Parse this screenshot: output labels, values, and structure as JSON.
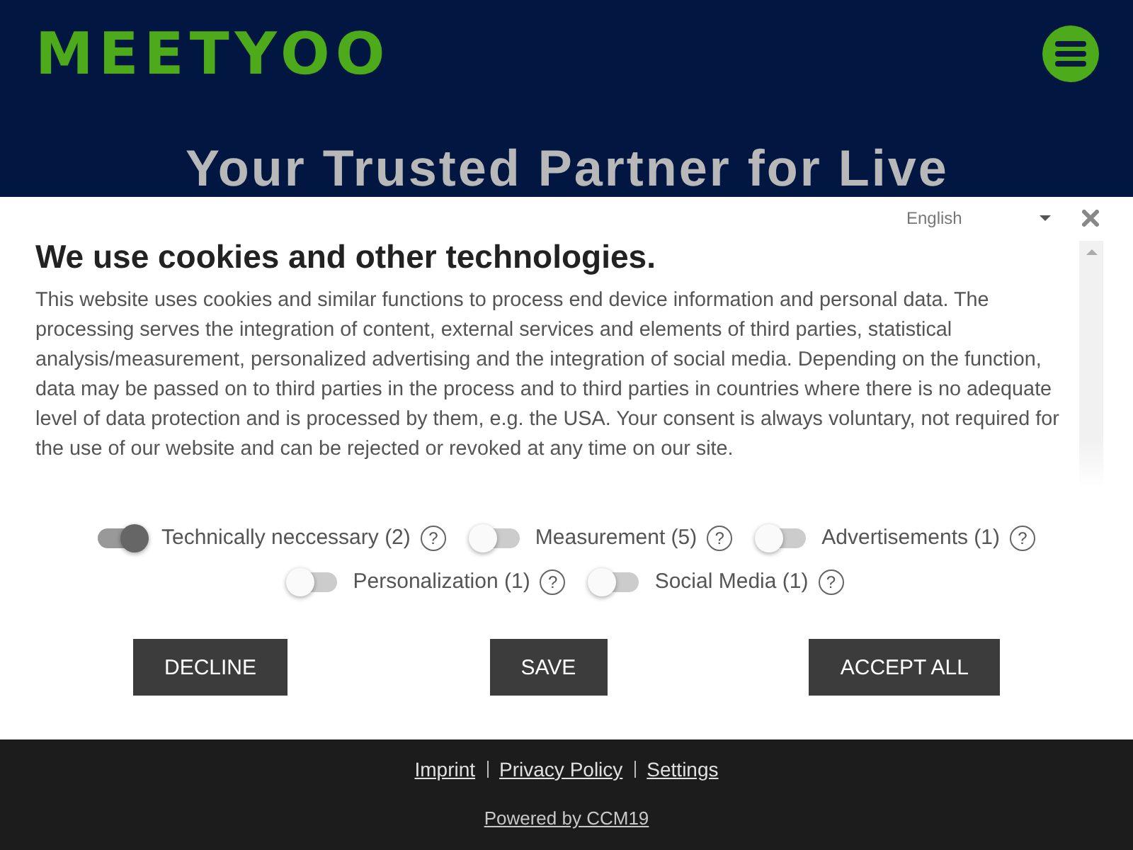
{
  "header": {
    "logo": "MEETYOO",
    "hero_title": "Your Trusted Partner for Live"
  },
  "cookie_dialog": {
    "language": "English",
    "title": "We use cookies and other technologies.",
    "text": "This website uses cookies and similar functions to process end device information and personal data. The processing serves the integration of content, external services and elements of third parties, statistical analysis/measurement, personalized advertising and the integration of social media. Depending on the function, data may be passed on to third parties in the process and to third parties in countries where there is no adequate level of data protection and is processed by them, e.g. the USA. Your consent is always voluntary, not required for the use of our website and can be rejected or revoked at any time on our site.",
    "categories": [
      {
        "label": "Technically neccessary (2)",
        "on": true,
        "help": "?"
      },
      {
        "label": "Measurement (5)",
        "on": false,
        "help": "?"
      },
      {
        "label": "Advertisements (1)",
        "on": false,
        "help": "?"
      },
      {
        "label": "Personalization (1)",
        "on": false,
        "help": "?"
      },
      {
        "label": "Social Media (1)",
        "on": false,
        "help": "?"
      }
    ],
    "buttons": [
      "DECLINE",
      "SAVE",
      "ACCEPT ALL"
    ]
  },
  "footer": {
    "links": [
      "Imprint",
      "Privacy Policy",
      "Settings"
    ],
    "powered_by": "Powered by CCM19"
  }
}
